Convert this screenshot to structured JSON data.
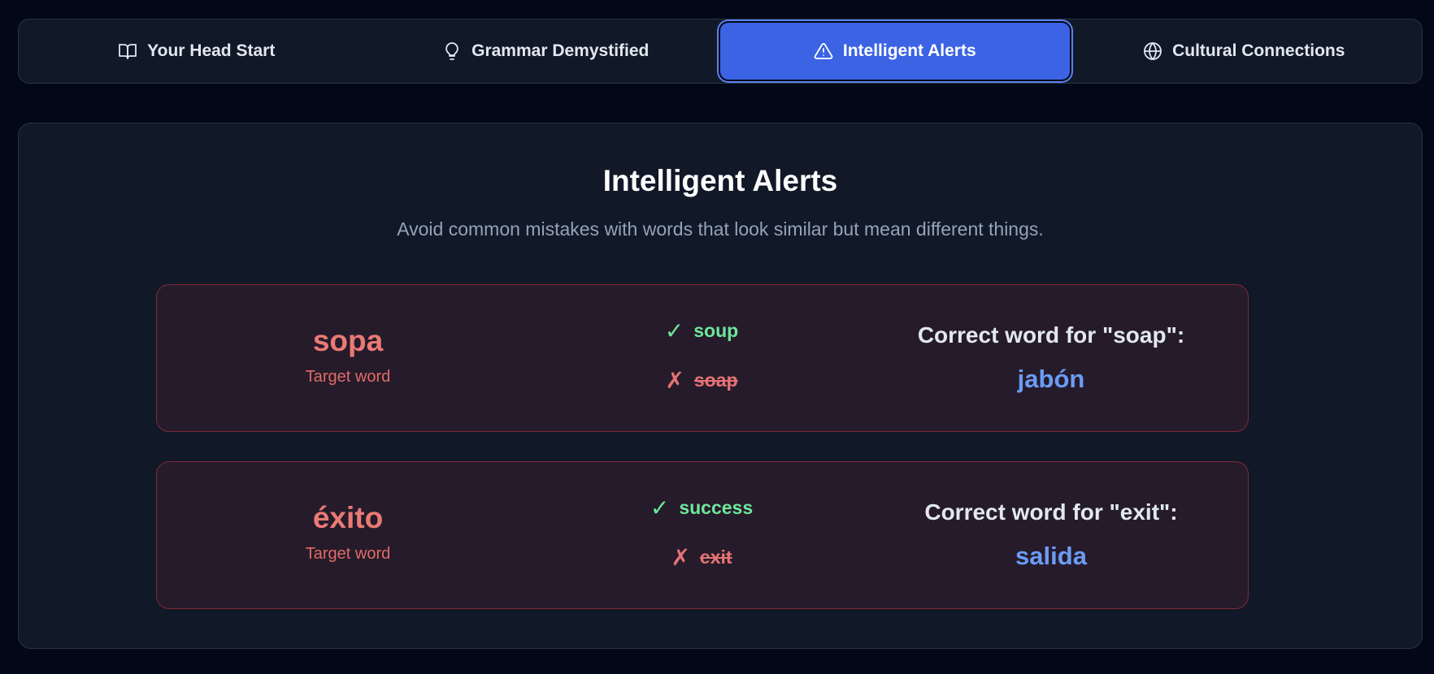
{
  "tabs": [
    {
      "label": "Your Head Start",
      "icon": "book-open-icon"
    },
    {
      "label": "Grammar Demystified",
      "icon": "lightbulb-icon"
    },
    {
      "label": "Intelligent Alerts",
      "icon": "warning-triangle-icon",
      "active": true
    },
    {
      "label": "Cultural Connections",
      "icon": "globe-icon"
    }
  ],
  "panel": {
    "title": "Intelligent Alerts",
    "subtitle": "Avoid common mistakes with words that look similar but mean different things."
  },
  "alerts": [
    {
      "target_word": "sopa",
      "target_label": "Target word",
      "correct_meaning": "soup",
      "wrong_meaning": "soap",
      "correct_for_label": "Correct word for \"soap\":",
      "correct_for_word": "jabón"
    },
    {
      "target_word": "éxito",
      "target_label": "Target word",
      "correct_meaning": "success",
      "wrong_meaning": "exit",
      "correct_for_label": "Correct word for \"exit\":",
      "correct_for_word": "salida"
    }
  ],
  "marks": {
    "check": "✓",
    "cross": "✗"
  },
  "colors": {
    "background": "#020817",
    "active_tab": "#3b63e4",
    "target_red": "#ea7a74",
    "right_green": "#6ee79a",
    "correct_blue": "#6b9cf4"
  }
}
